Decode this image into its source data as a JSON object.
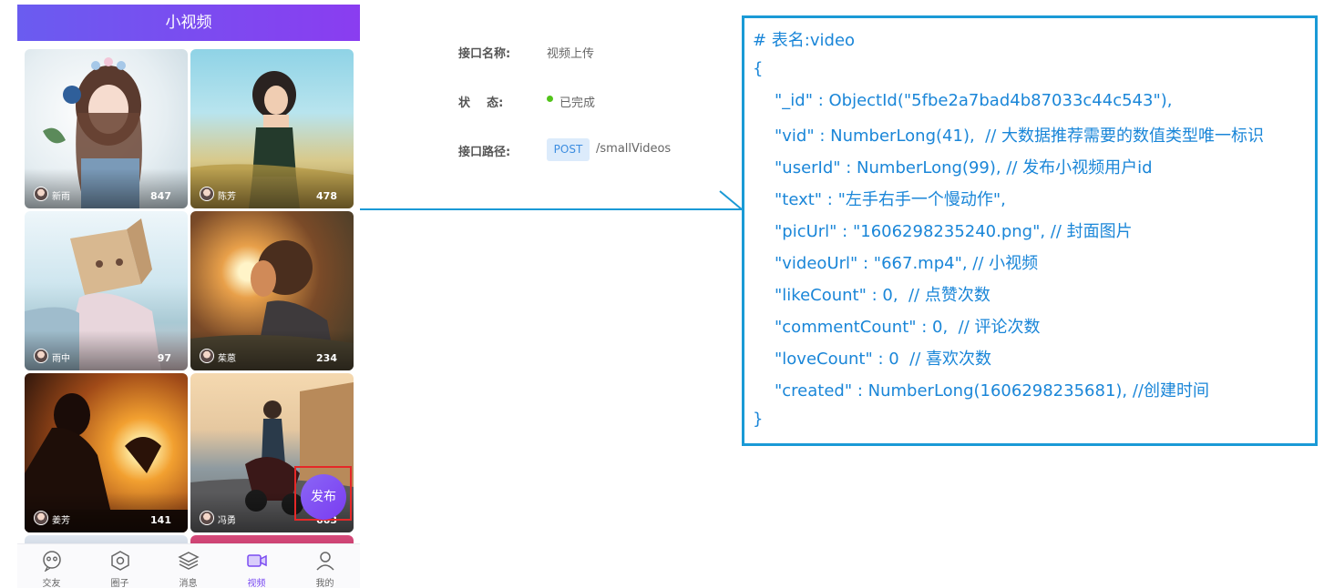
{
  "phone": {
    "header_title": "小视频",
    "cards": [
      {
        "name": "新雨",
        "count": "847"
      },
      {
        "name": "陈芳",
        "count": "478"
      },
      {
        "name": "雨中",
        "count": "97"
      },
      {
        "name": "茱蒽",
        "count": "234"
      },
      {
        "name": "姜芳",
        "count": "141"
      },
      {
        "name": "冯勇",
        "count": "663"
      }
    ],
    "fab_label": "发布",
    "tabs": [
      {
        "label": "交友",
        "icon": "chat-face-icon"
      },
      {
        "label": "圈子",
        "icon": "hexagon-icon"
      },
      {
        "label": "消息",
        "icon": "layers-icon"
      },
      {
        "label": "视频",
        "icon": "video-camera-icon",
        "active": true
      },
      {
        "label": "我的",
        "icon": "user-icon"
      }
    ],
    "accent_color": "#7b4cf2"
  },
  "api": {
    "name_label": "接口名称:",
    "name_value": "视频上传",
    "status_label": "状    态:",
    "status_value": "已完成",
    "path_label": "接口路径:",
    "method": "POST",
    "path": "/smallVideos"
  },
  "code": {
    "lines": [
      "# 表名:video",
      "{",
      "\"_id\" : ObjectId(\"5fbe2a7bad4b87033c44c543\"),",
      "\"vid\" : NumberLong(41),  // 大数据推荐需要的数值类型唯一标识",
      "\"userId\" : NumberLong(99), // 发布小视频用户id",
      "\"text\" : \"左手右手一个慢动作\",",
      "\"picUrl\" : \"1606298235240.png\", // 封面图片",
      "\"videoUrl\" : \"667.mp4\", // 小视频",
      "\"likeCount\" : 0,  // 点赞次数",
      "\"commentCount\" : 0,  // 评论次数",
      "\"loveCount\" : 0  // 喜欢次数",
      "\"created\" : NumberLong(1606298235681), //创建时间",
      "}"
    ],
    "border_color": "#1a9ad6",
    "text_color": "#1a86d8"
  }
}
